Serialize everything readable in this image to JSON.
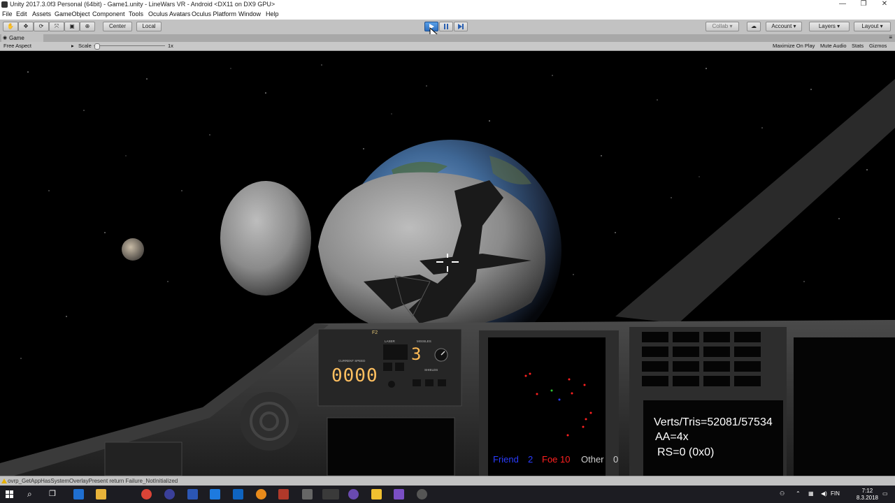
{
  "window": {
    "title": "Unity 2017.3.0f3 Personal (64bit) - Game1.unity - LineWars VR - Android <DX11 on DX9 GPU>",
    "controls": [
      "—",
      "❐",
      "✕"
    ]
  },
  "menu": [
    "File",
    "Edit",
    "Assets",
    "GameObject",
    "Component",
    "Tools",
    "Oculus Avatars",
    "Oculus Platform",
    "Window",
    "Help"
  ],
  "toolbar": {
    "pivot": "Center",
    "space": "Local",
    "collab": "Collab",
    "account": "Account",
    "layers": "Layers",
    "layout": "Layout"
  },
  "game_view": {
    "tab": "Game",
    "aspect": "Free Aspect",
    "scale_label": "Scale",
    "scale_value": "1x",
    "maximize": "Maximize On Play",
    "mute": "Mute Audio",
    "stats": "Stats",
    "gizmos": "Gizmos"
  },
  "cockpit": {
    "panel_id": "F2",
    "laser_label": "LASER",
    "missiles_label": "MISSILES",
    "missile_count": "3",
    "current_speed_label": "CURRENT SPEED",
    "current_speed": "0000",
    "shields_label": "SHIELDS"
  },
  "stats": {
    "verts_tris": "Verts/Tris=52081/57534",
    "aa": "AA=4x",
    "rs": "RS=0 (0x0)"
  },
  "radar": {
    "friend_label": "Friend",
    "friend_count": "2",
    "foe_label": "Foe",
    "foe_count": "10",
    "other_label": "Other",
    "other_count": "0",
    "colors": {
      "friend": "#2a3cff",
      "foe": "#ff2020",
      "other": "#cfcfcf"
    }
  },
  "console": {
    "message": "ovrp_GetAppHasSystemOverlayPresent return Failure_NotInitialized"
  },
  "taskbar": {
    "language": "FIN",
    "time": "7:12",
    "date": "8.3.2018"
  }
}
